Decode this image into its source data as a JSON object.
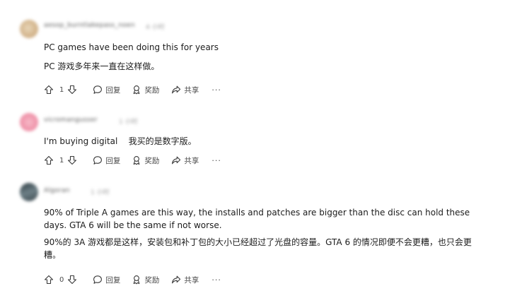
{
  "comments": [
    {
      "username": "aesop_burntlakepass_noen",
      "time": "4 小时",
      "avatar_color": "#d9c3a2",
      "lines": [
        "PC games have been doing this for years",
        "PC 游戏多年来一直在这样做。"
      ],
      "votes": "1",
      "reply_label": "回复",
      "award_label": "奖励",
      "share_label": "共享",
      "more_label": "···"
    },
    {
      "username": "vicromangusser",
      "time": "1 小时",
      "avatar_color": "#f0a6b8",
      "lines": [
        "I'm buying digital    我买的是数字版。"
      ],
      "votes": "1",
      "reply_label": "回复",
      "award_label": "奖励",
      "share_label": "共享",
      "more_label": "···"
    },
    {
      "username": "Algoran",
      "time": "1 小时",
      "avatar_color": "#5a6a70",
      "lines": [
        "90% of Triple A games are this way, the installs and patches are bigger than the disc can hold these days. GTA 6 will be the same if not worse.",
        "90%的 3A 游戏都是这样，安装包和补丁包的大小已经超过了光盘的容量。GTA 6 的情况即便不会更糟，也只会更糟。"
      ],
      "votes": "0",
      "reply_label": "回复",
      "award_label": "奖励",
      "share_label": "共享",
      "more_label": "···"
    }
  ],
  "icons": {
    "upvote": "arrow-up-icon",
    "downvote": "arrow-down-icon",
    "reply": "comment-bubble-icon",
    "award": "award-medal-icon",
    "share": "share-arrow-icon"
  }
}
